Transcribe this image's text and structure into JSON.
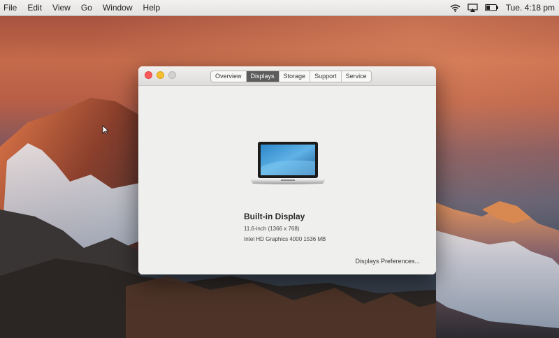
{
  "menubar": {
    "items": [
      "File",
      "Edit",
      "View",
      "Go",
      "Window",
      "Help"
    ],
    "clock": "Tue. 4:18 pm",
    "status_icons": [
      "wifi-icon",
      "airplay-icon",
      "battery-icon"
    ]
  },
  "about_window": {
    "tabs": [
      "Overview",
      "Displays",
      "Storage",
      "Support",
      "Service"
    ],
    "active_tab": "Displays",
    "display": {
      "name": "Built-in Display",
      "size": "11.6-inch (1366 x 768)",
      "graphics": "Intel HD Graphics 4000 1536 MB"
    },
    "preferences_button": "Displays Preferences..."
  },
  "colors": {
    "active_tab_bg": "#5c5c5c",
    "close_button": "#fc5b57",
    "minimize_button": "#f5bd2f",
    "window_bg": "#efefed"
  }
}
